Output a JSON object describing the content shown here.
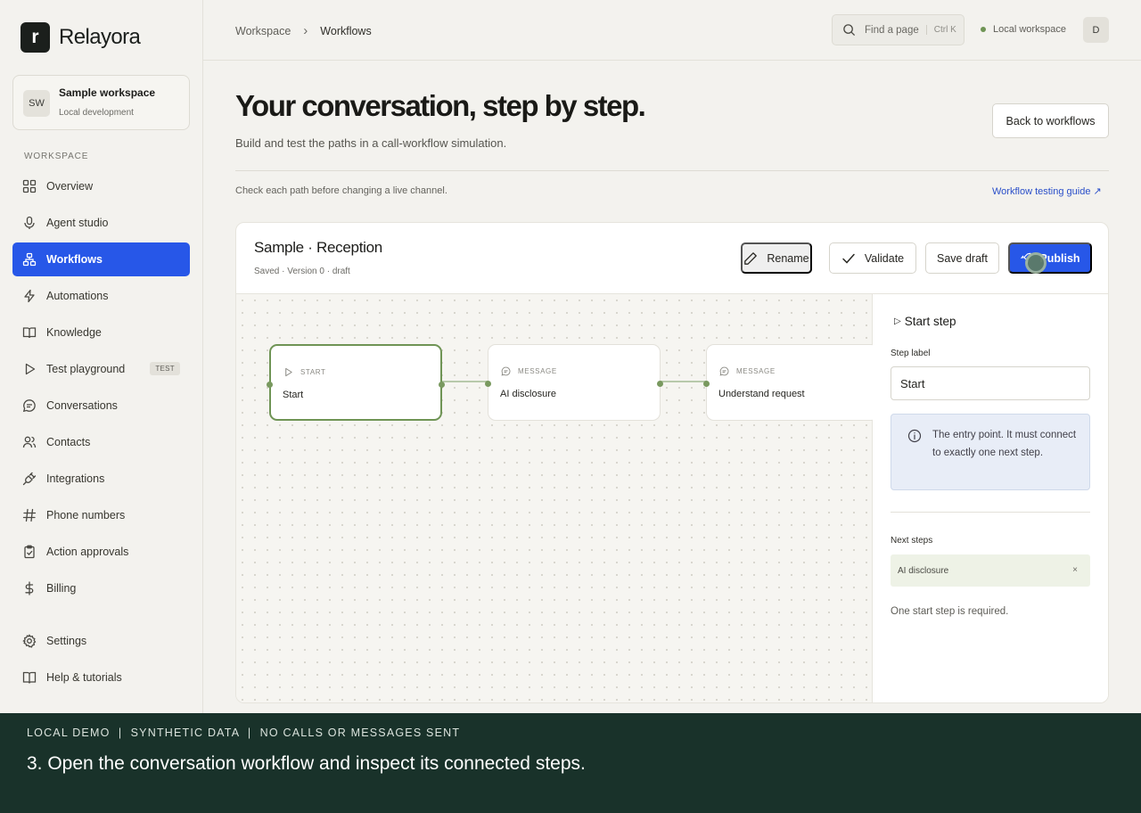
{
  "app": {
    "logo_letter": "r",
    "name": "Relayora"
  },
  "workspace_card": {
    "initials": "SW",
    "name": "Sample workspace",
    "env": "Local development"
  },
  "sidebar": {
    "section_label": "WORKSPACE",
    "items": [
      {
        "label": "Overview",
        "icon": "grid-icon"
      },
      {
        "label": "Agent studio",
        "icon": "microphone-icon"
      },
      {
        "label": "Workflows",
        "icon": "workflow-icon",
        "active": true
      },
      {
        "label": "Automations",
        "icon": "lightning-icon"
      },
      {
        "label": "Knowledge",
        "icon": "book-icon"
      },
      {
        "label": "Test playground",
        "icon": "play-icon",
        "badge": "TEST"
      },
      {
        "label": "Conversations",
        "icon": "chat-icon"
      },
      {
        "label": "Contacts",
        "icon": "users-icon"
      },
      {
        "label": "Integrations",
        "icon": "plug-icon"
      },
      {
        "label": "Phone numbers",
        "icon": "hash-icon"
      },
      {
        "label": "Action approvals",
        "icon": "clipboard-check-icon"
      },
      {
        "label": "Billing",
        "icon": "dollar-icon"
      },
      {
        "label": "Settings",
        "icon": "gear-icon"
      },
      {
        "label": "Help & tutorials",
        "icon": "book-open-icon"
      }
    ]
  },
  "topbar": {
    "breadcrumb": [
      "Workspace",
      "Workflows"
    ],
    "search_placeholder": "Find a page",
    "search_shortcut": "Ctrl K",
    "status_label": "Local workspace",
    "user_initial": "D"
  },
  "page": {
    "title": "Your conversation, step by step.",
    "subtitle": "Build and test the paths in a call-workflow simulation.",
    "back_button": "Back to workflows",
    "hint": "Check each path before changing a live channel.",
    "guide_link": "Workflow testing guide ↗"
  },
  "editor": {
    "title": "Sample · Reception",
    "meta": "Saved · Version 0 · draft",
    "buttons": {
      "rename": "Rename",
      "validate": "Validate",
      "save": "Save draft",
      "publish": "Publish"
    },
    "nodes": [
      {
        "kind": "START",
        "label": "Start",
        "selected": true
      },
      {
        "kind": "MESSAGE",
        "label": "AI disclosure"
      },
      {
        "kind": "MESSAGE",
        "label": "Understand request"
      }
    ]
  },
  "panel": {
    "title": "Start step",
    "step_label_title": "Step label",
    "step_label_value": "Start",
    "info": "The entry point. It must connect to exactly one next step.",
    "next_steps_title": "Next steps",
    "next_step_chip": "AI disclosure",
    "chip_remove": "×",
    "note": "One start step is required."
  },
  "caption": {
    "top": "LOCAL DEMO  |  SYNTHETIC DATA  |  NO CALLS OR MESSAGES SENT",
    "main": "3. Open the conversation workflow and inspect its connected steps."
  },
  "colors": {
    "accent": "#2757e8",
    "node_selected": "#6f9455",
    "caption_bg": "#19322a"
  }
}
